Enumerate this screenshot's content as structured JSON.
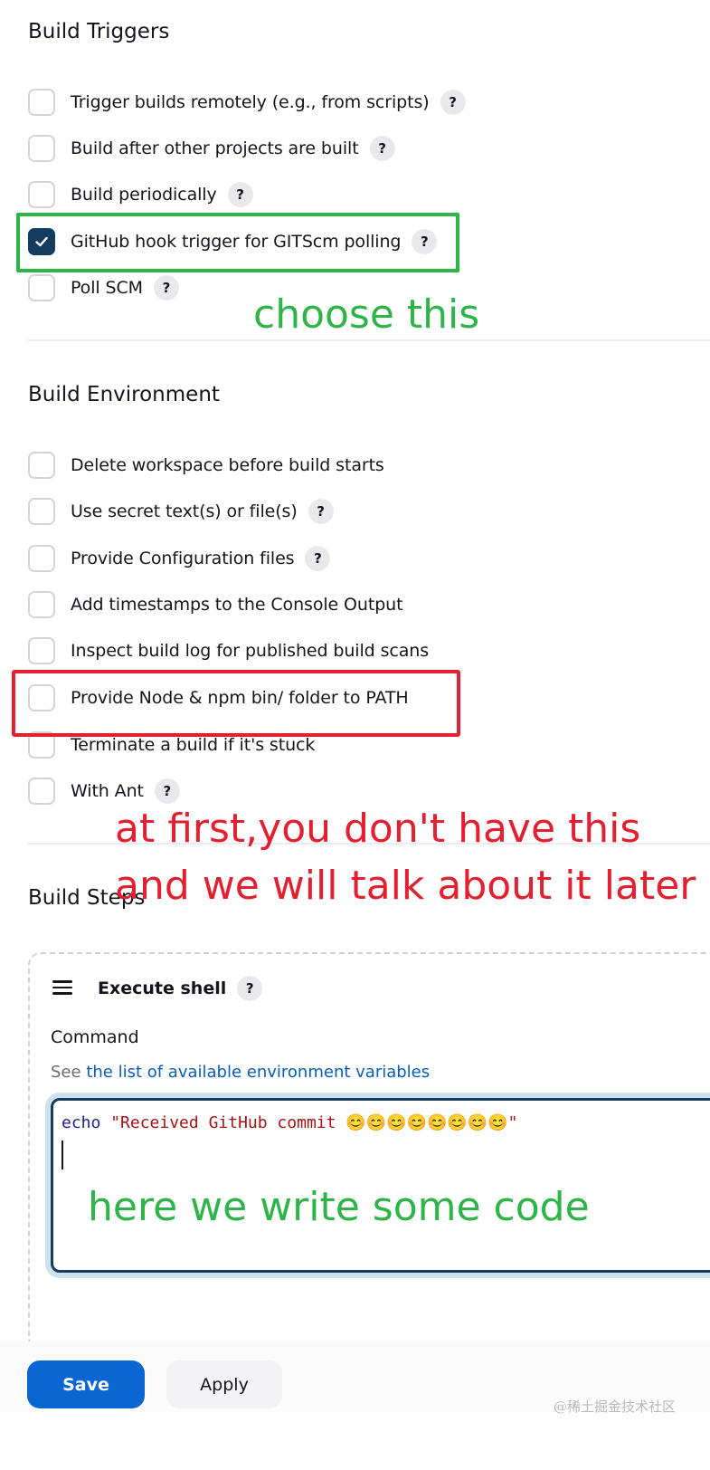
{
  "build_triggers": {
    "title": "Build Triggers",
    "options": [
      {
        "label": "Trigger builds remotely (e.g., from scripts)",
        "checked": false,
        "help": "?"
      },
      {
        "label": "Build after other projects are built",
        "checked": false,
        "help": "?"
      },
      {
        "label": "Build periodically",
        "checked": false,
        "help": "?"
      },
      {
        "label": "GitHub hook trigger for GITScm polling",
        "checked": true,
        "help": "?"
      },
      {
        "label": "Poll SCM",
        "checked": false,
        "help": "?"
      }
    ]
  },
  "build_environment": {
    "title": "Build Environment",
    "options": [
      {
        "label": "Delete workspace before build starts",
        "checked": false
      },
      {
        "label": "Use secret text(s) or file(s)",
        "checked": false,
        "help": "?"
      },
      {
        "label": "Provide Configuration files",
        "checked": false,
        "help": "?"
      },
      {
        "label": "Add timestamps to the Console Output",
        "checked": false
      },
      {
        "label": "Inspect build log for published build scans",
        "checked": false
      },
      {
        "label": "Provide Node & npm bin/ folder to PATH",
        "checked": false
      },
      {
        "label": "Terminate a build if it's stuck",
        "checked": false
      },
      {
        "label": "With Ant",
        "checked": false,
        "help": "?"
      }
    ]
  },
  "build_steps": {
    "title": "Build Steps",
    "step": {
      "title": "Execute shell",
      "help": "?",
      "command_label": "Command",
      "see_prefix": "See",
      "env_link": "the list of available environment variables",
      "code_keyword": "echo",
      "code_string": "\"Received GitHub commit 😊😊😊😊😊😊😊😊\""
    }
  },
  "annotations": {
    "choose": "choose this",
    "first_line1": "at first,you don't have this",
    "first_line2": "and we will talk about it later",
    "code_note": "here we write some code",
    "green": "#2fb44a",
    "red": "#e3202f"
  },
  "footer": {
    "save": "Save",
    "apply": "Apply",
    "watermark": "@稀土掘金技术社区"
  },
  "colors": {
    "primary": "#0a66d2",
    "checkbox_checked": "#133c5f",
    "link": "#0b5cb5"
  }
}
